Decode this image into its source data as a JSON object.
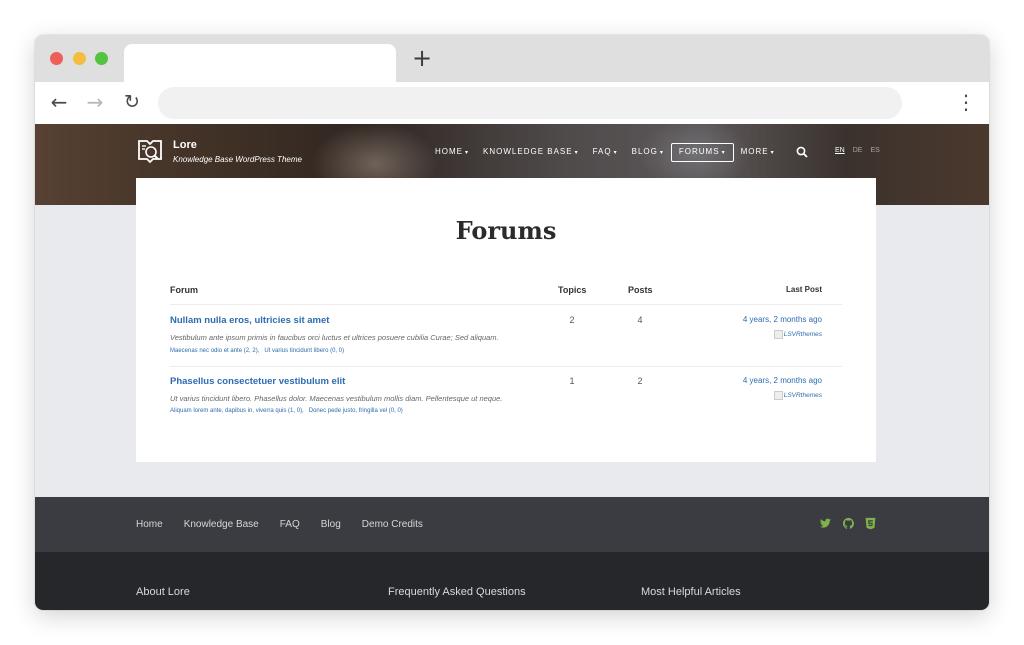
{
  "browser": {
    "new_tab_glyph": "+",
    "back_glyph": "←",
    "forward_glyph": "→",
    "reload_glyph": "↻",
    "menu_glyph": "⋮"
  },
  "site": {
    "name": "Lore",
    "tagline": "Knowledge Base WordPress Theme",
    "nav": [
      {
        "label": "HOME",
        "caret": "▾"
      },
      {
        "label": "KNOWLEDGE BASE",
        "caret": "▾"
      },
      {
        "label": "FAQ",
        "caret": "▾"
      },
      {
        "label": "BLOG",
        "caret": "▾"
      },
      {
        "label": "FORUMS",
        "caret": "▾"
      },
      {
        "label": "MORE",
        "caret": "▾"
      }
    ],
    "languages": [
      "EN",
      "DE",
      "ES"
    ],
    "active_nav": "FORUMS",
    "current_language": "EN"
  },
  "page": {
    "title": "Forums",
    "table": {
      "headers": {
        "forum": "Forum",
        "topics": "Topics",
        "posts": "Posts",
        "last_post": "Last Post"
      },
      "rows": [
        {
          "title": "Nullam nulla eros, ultricies sit amet",
          "description": "Vestibulum ante ipsum primis in faucibus orci luctus et ultrices posuere cubilia Curae; Sed aliquam.",
          "subforums": [
            "Maecenas nec odio et ante (2, 2),",
            "Ut varius tincidunt libero (0, 0)"
          ],
          "topics": "2",
          "posts": "4",
          "freshness": "4 years, 2 months ago",
          "author": "LSVRthemes"
        },
        {
          "title": "Phasellus consectetuer vestibulum elit",
          "description": "Ut varius tincidunt libero. Phasellus dolor. Maecenas vestibulum mollis diam. Pellentesque ut neque.",
          "subforums": [
            "Aliquam lorem ante, dapibus in, viverra quis (1, 0),",
            "Donec pede justo, fringilla vel (0, 0)"
          ],
          "topics": "1",
          "posts": "2",
          "freshness": "4 years, 2 months ago",
          "author": "LSVRthemes"
        }
      ]
    }
  },
  "footer": {
    "nav": [
      "Home",
      "Knowledge Base",
      "FAQ",
      "Blog",
      "Demo Credits"
    ],
    "social_icons": [
      "twitter-icon",
      "github-icon",
      "html5-icon"
    ],
    "columns": [
      "About Lore",
      "Frequently Asked Questions",
      "Most Helpful Articles"
    ]
  },
  "colors": {
    "link": "#2d6cb0",
    "social": "#7fb24a",
    "footer_top": "#3a3c42",
    "footer_bottom": "#26272b"
  }
}
